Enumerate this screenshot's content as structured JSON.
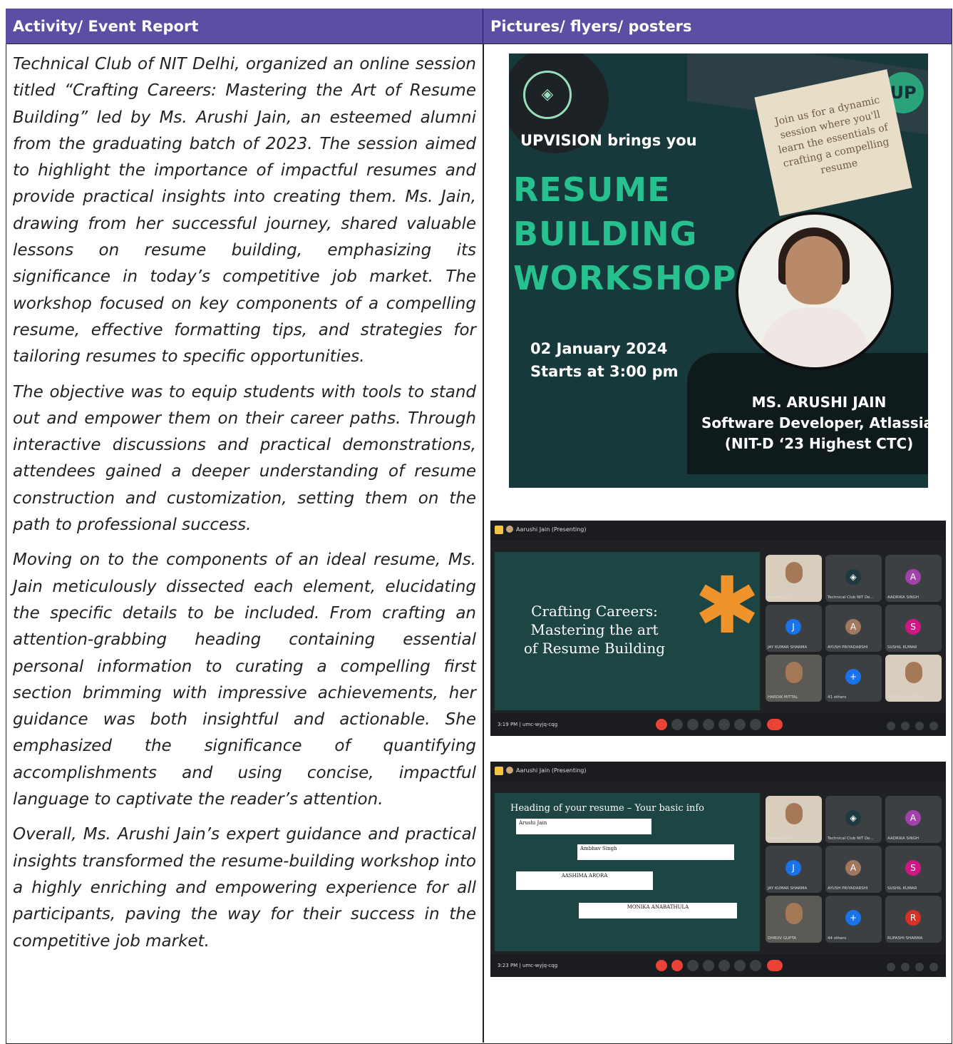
{
  "header": {
    "left": "Activity/ Event Report",
    "right": "Pictures/ flyers/ posters"
  },
  "report": {
    "p1": "Technical Club of NIT Delhi, organized an online session titled “Crafting Careers: Mastering the Art of Resume Building” led by Ms. Arushi Jain, an esteemed alumni from the graduating batch of 2023. The session aimed to highlight the importance of impactful resumes and provide practical insights into creating them. Ms. Jain, drawing from her successful journey, shared valuable lessons on resume building, emphasizing its significance in today’s competitive job market. The workshop focused on key components of a compelling resume, effective formatting tips, and strategies for tailoring resumes to specific opportunities.",
    "p2": "The objective was to equip students with tools to stand out and empower them on their career paths. Through interactive discussions and practical demonstrations, attendees gained a deeper understanding of resume construction and customization, setting them on the path to professional success.",
    "p3": "Moving on to the components of an ideal resume, Ms. Jain meticulously dissected each element, elucidating the specific details to be included. From crafting an attention-grabbing heading containing essential personal information to curating a compelling first section brimming with impressive achievements, her guidance was both insightful and actionable. She emphasized the significance of quantifying accomplishments and using concise, impactful language to captivate the reader’s attention.",
    "p4": "Overall, Ms. Arushi Jain’s expert guidance and practical insights transformed the resume-building workshop into a highly enriching and empowering experience for all participants, paving the way for their success in the competitive job market."
  },
  "poster": {
    "note": "Join us for a dynamic session where you'll learn the essentials of crafting a compelling resume",
    "brings": "UPVISION brings you",
    "line1": "RESUME",
    "line2": "BUILDING",
    "line3": "WORKSHOP",
    "date": "02 January 2024",
    "time": "Starts at 3:00 pm",
    "speaker": "MS. ARUSHI JAIN",
    "role": "Software Developer, Atlassian",
    "ctc": "(NIT-D ‘23 Highest CTC)"
  },
  "meet1": {
    "presenting": "Aarushi Jain (Presenting)",
    "slide_title": "Crafting Careers: Mastering the art of Resume Building",
    "clock": "3:19 PM  |  umc-wyjq-cqg",
    "tiles": [
      {
        "name": "Aarushi Jain",
        "initial": "",
        "color": ""
      },
      {
        "name": "Technical Club NIT De...",
        "initial": "",
        "color": "#1c3a40"
      },
      {
        "name": "AADRIKA SINGH",
        "initial": "A",
        "color": "#a142a8"
      },
      {
        "name": "JAY KUMAR SHARMA",
        "initial": "J",
        "color": "#1a73e8"
      },
      {
        "name": "AYUSH PRIYADARSHI",
        "initial": "A",
        "color": "#a1775f"
      },
      {
        "name": "SUSHIL KUMAR",
        "initial": "S",
        "color": "#d01884"
      },
      {
        "name": "HARDIK MITTAL",
        "initial": "",
        "color": ""
      },
      {
        "name": "41 others",
        "initial": "",
        "color": ""
      },
      {
        "name": "RUPASHI SHARMA",
        "initial": "",
        "color": ""
      }
    ]
  },
  "meet2": {
    "presenting": "Aarushi Jain (Presenting)",
    "slide_heading": "Heading of your resume – Your basic info",
    "cards": [
      "Arushi Jain",
      "Ambhav Singh",
      "AASHIMA ARORA",
      "MONIKA ANABATHULA"
    ],
    "clock": "3:23 PM  |  umc-wyjq-cqg",
    "tiles": [
      {
        "name": "Aarushi Jain",
        "initial": "",
        "color": ""
      },
      {
        "name": "Technical Club NIT De...",
        "initial": "",
        "color": "#1c3a40"
      },
      {
        "name": "AADRIKA SINGH",
        "initial": "A",
        "color": "#a142a8"
      },
      {
        "name": "JAY KUMAR SHARMA",
        "initial": "J",
        "color": "#1a73e8"
      },
      {
        "name": "AYUSH PRIYADARSHI",
        "initial": "A",
        "color": "#a1775f"
      },
      {
        "name": "SUSHIL KUMAR",
        "initial": "S",
        "color": "#d01884"
      },
      {
        "name": "DHRUV GUPTA",
        "initial": "",
        "color": ""
      },
      {
        "name": "44 others",
        "initial": "",
        "color": ""
      },
      {
        "name": "RUPASHI SHARMA",
        "initial": "R",
        "color": "#d93025"
      }
    ]
  }
}
